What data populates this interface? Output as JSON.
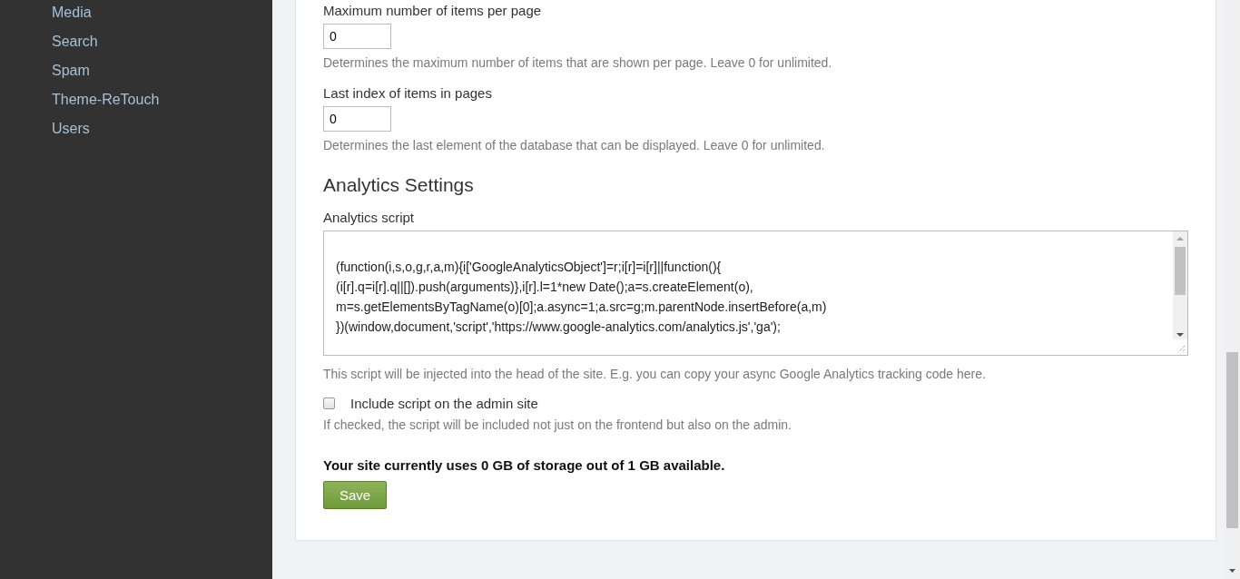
{
  "sidebar": {
    "items": [
      {
        "label": "Media"
      },
      {
        "label": "Search"
      },
      {
        "label": "Spam"
      },
      {
        "label": "Theme-ReTouch"
      },
      {
        "label": "Users"
      }
    ]
  },
  "form": {
    "fields": [
      {
        "kind": "number",
        "label": "Maximum number of items per page",
        "value": "0",
        "help": "Determines the maximum number of items that are shown per page. Leave 0 for unlimited."
      },
      {
        "kind": "number",
        "label": "Last index of items in pages",
        "value": "0",
        "help": "Determines the last element of the database that can be displayed. Leave 0 for unlimited."
      },
      {
        "kind": "heading",
        "text": "Analytics Settings"
      },
      {
        "kind": "textarea",
        "label": "Analytics script",
        "value": "\n(function(i,s,o,g,r,a,m){i['GoogleAnalyticsObject']=r;i[r]=i[r]||function(){\n(i[r].q=i[r].q||[]).push(arguments)},i[r].l=1*new Date();a=s.createElement(o),\nm=s.getElementsByTagName(o)[0];a.async=1;a.src=g;m.parentNode.insertBefore(a,m)\n})(window,document,'script','https://www.google-analytics.com/analytics.js','ga');",
        "help": "This script will be injected into the head of the site. E.g. you can copy your async Google Analytics tracking code here."
      },
      {
        "kind": "checkbox",
        "label": "Include script on the admin site",
        "checked": false,
        "help": "If checked, the script will be included not just on the frontend but also on the admin."
      }
    ],
    "storage_note": "Your site currently uses 0 GB of storage out of 1 GB available.",
    "save_button": "Save"
  }
}
